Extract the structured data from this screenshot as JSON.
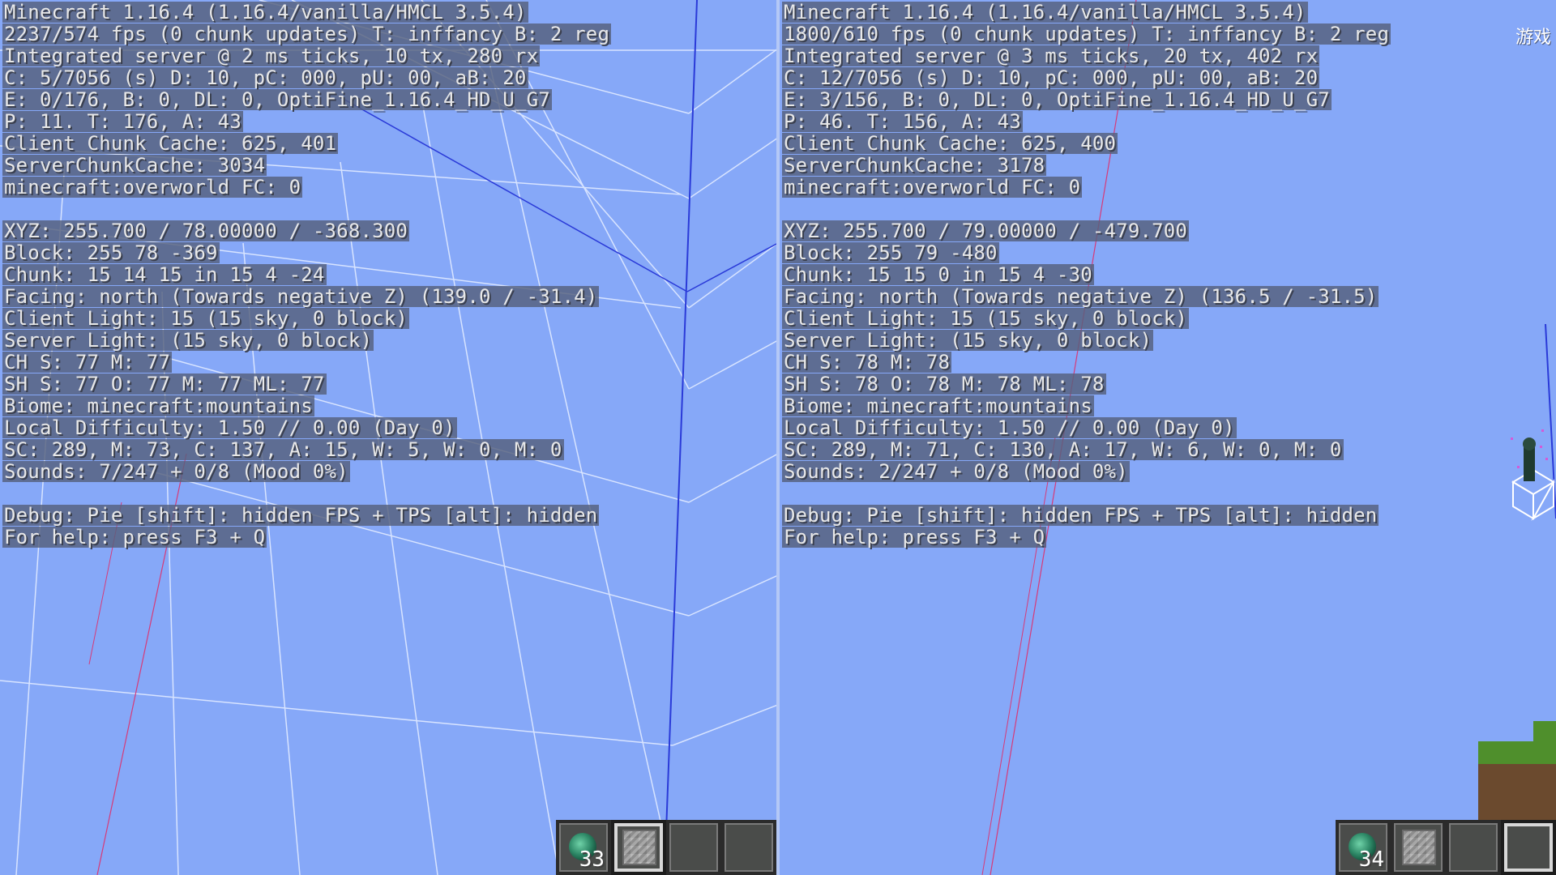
{
  "left": {
    "debug_lines": [
      "Minecraft 1.16.4 (1.16.4/vanilla/HMCL 3.5.4)",
      "2237/574 fps (0 chunk updates) T: inffancy B: 2 reg",
      "Integrated server @ 2 ms ticks, 10 tx, 280 rx",
      "C: 5/7056 (s) D: 10, pC: 000, pU: 00, aB: 20",
      "E: 0/176, B: 0, DL: 0, OptiFine_1.16.4_HD_U_G7",
      "P: 11. T: 176, A: 43",
      "Client Chunk Cache: 625, 401",
      "ServerChunkCache: 3034",
      "minecraft:overworld FC: 0",
      "",
      "XYZ: 255.700 / 78.00000 / -368.300",
      "Block: 255 78 -369",
      "Chunk: 15 14 15 in 15 4 -24",
      "Facing: north (Towards negative Z) (139.0 / -31.4)",
      "Client Light: 15 (15 sky, 0 block)",
      "Server Light: (15 sky, 0 block)",
      "CH S: 77 M: 77",
      "SH S: 77 O: 77 M: 77 ML: 77",
      "Biome: minecraft:mountains",
      "Local Difficulty: 1.50 // 0.00 (Day 0)",
      "SC: 289, M: 73, C: 137, A: 15, W: 5, W: 0, M: 0",
      "Sounds: 7/247 + 0/8 (Mood 0%)",
      "",
      "Debug: Pie [shift]: hidden FPS + TPS [alt]: hidden",
      "For help: press F3 + Q"
    ],
    "hotbar": {
      "pearl_count": "33",
      "slots": [
        "ender_pearl",
        "stone_block",
        "empty",
        "empty",
        "empty"
      ],
      "selected_slot": 1
    }
  },
  "right": {
    "debug_lines": [
      "Minecraft 1.16.4 (1.16.4/vanilla/HMCL 3.5.4)",
      "1800/610 fps (0 chunk updates) T: inffancy B: 2 reg",
      "Integrated server @ 3 ms ticks, 20 tx, 402 rx",
      "C: 12/7056 (s) D: 10, pC: 000, pU: 00, aB: 20",
      "E: 3/156, B: 0, DL: 0, OptiFine_1.16.4_HD_U_G7",
      "P: 46. T: 156, A: 43",
      "Client Chunk Cache: 625, 400",
      "ServerChunkCache: 3178",
      "minecraft:overworld FC: 0",
      "",
      "XYZ: 255.700 / 79.00000 / -479.700",
      "Block: 255 79 -480",
      "Chunk: 15 15 0 in 15 4 -30",
      "Facing: north (Towards negative Z) (136.5 / -31.5)",
      "Client Light: 15 (15 sky, 0 block)",
      "Server Light: (15 sky, 0 block)",
      "CH S: 78 M: 78",
      "SH S: 78 O: 78 M: 78 ML: 78",
      "Biome: minecraft:mountains",
      "Local Difficulty: 1.50 // 0.00 (Day 0)",
      "SC: 289, M: 71, C: 130, A: 17, W: 6, W: 0, M: 0",
      "Sounds: 2/247 + 0/8 (Mood 0%)",
      "",
      "Debug: Pie [shift]: hidden FPS + TPS [alt]: hidden",
      "For help: press F3 + Q"
    ],
    "hotbar": {
      "pearl_count": "34",
      "slots": [
        "ender_pearl",
        "stone_block",
        "empty",
        "empty"
      ],
      "selected_slot": 3
    },
    "ime_indicator": "游戏"
  },
  "colors": {
    "sky": "#86a8f8",
    "chunk_border_line": "#d8e4ff",
    "chunk_axis_line": "#2a3ad8",
    "debug_background": "#55607d",
    "debug_text": "#e8e8e8"
  }
}
